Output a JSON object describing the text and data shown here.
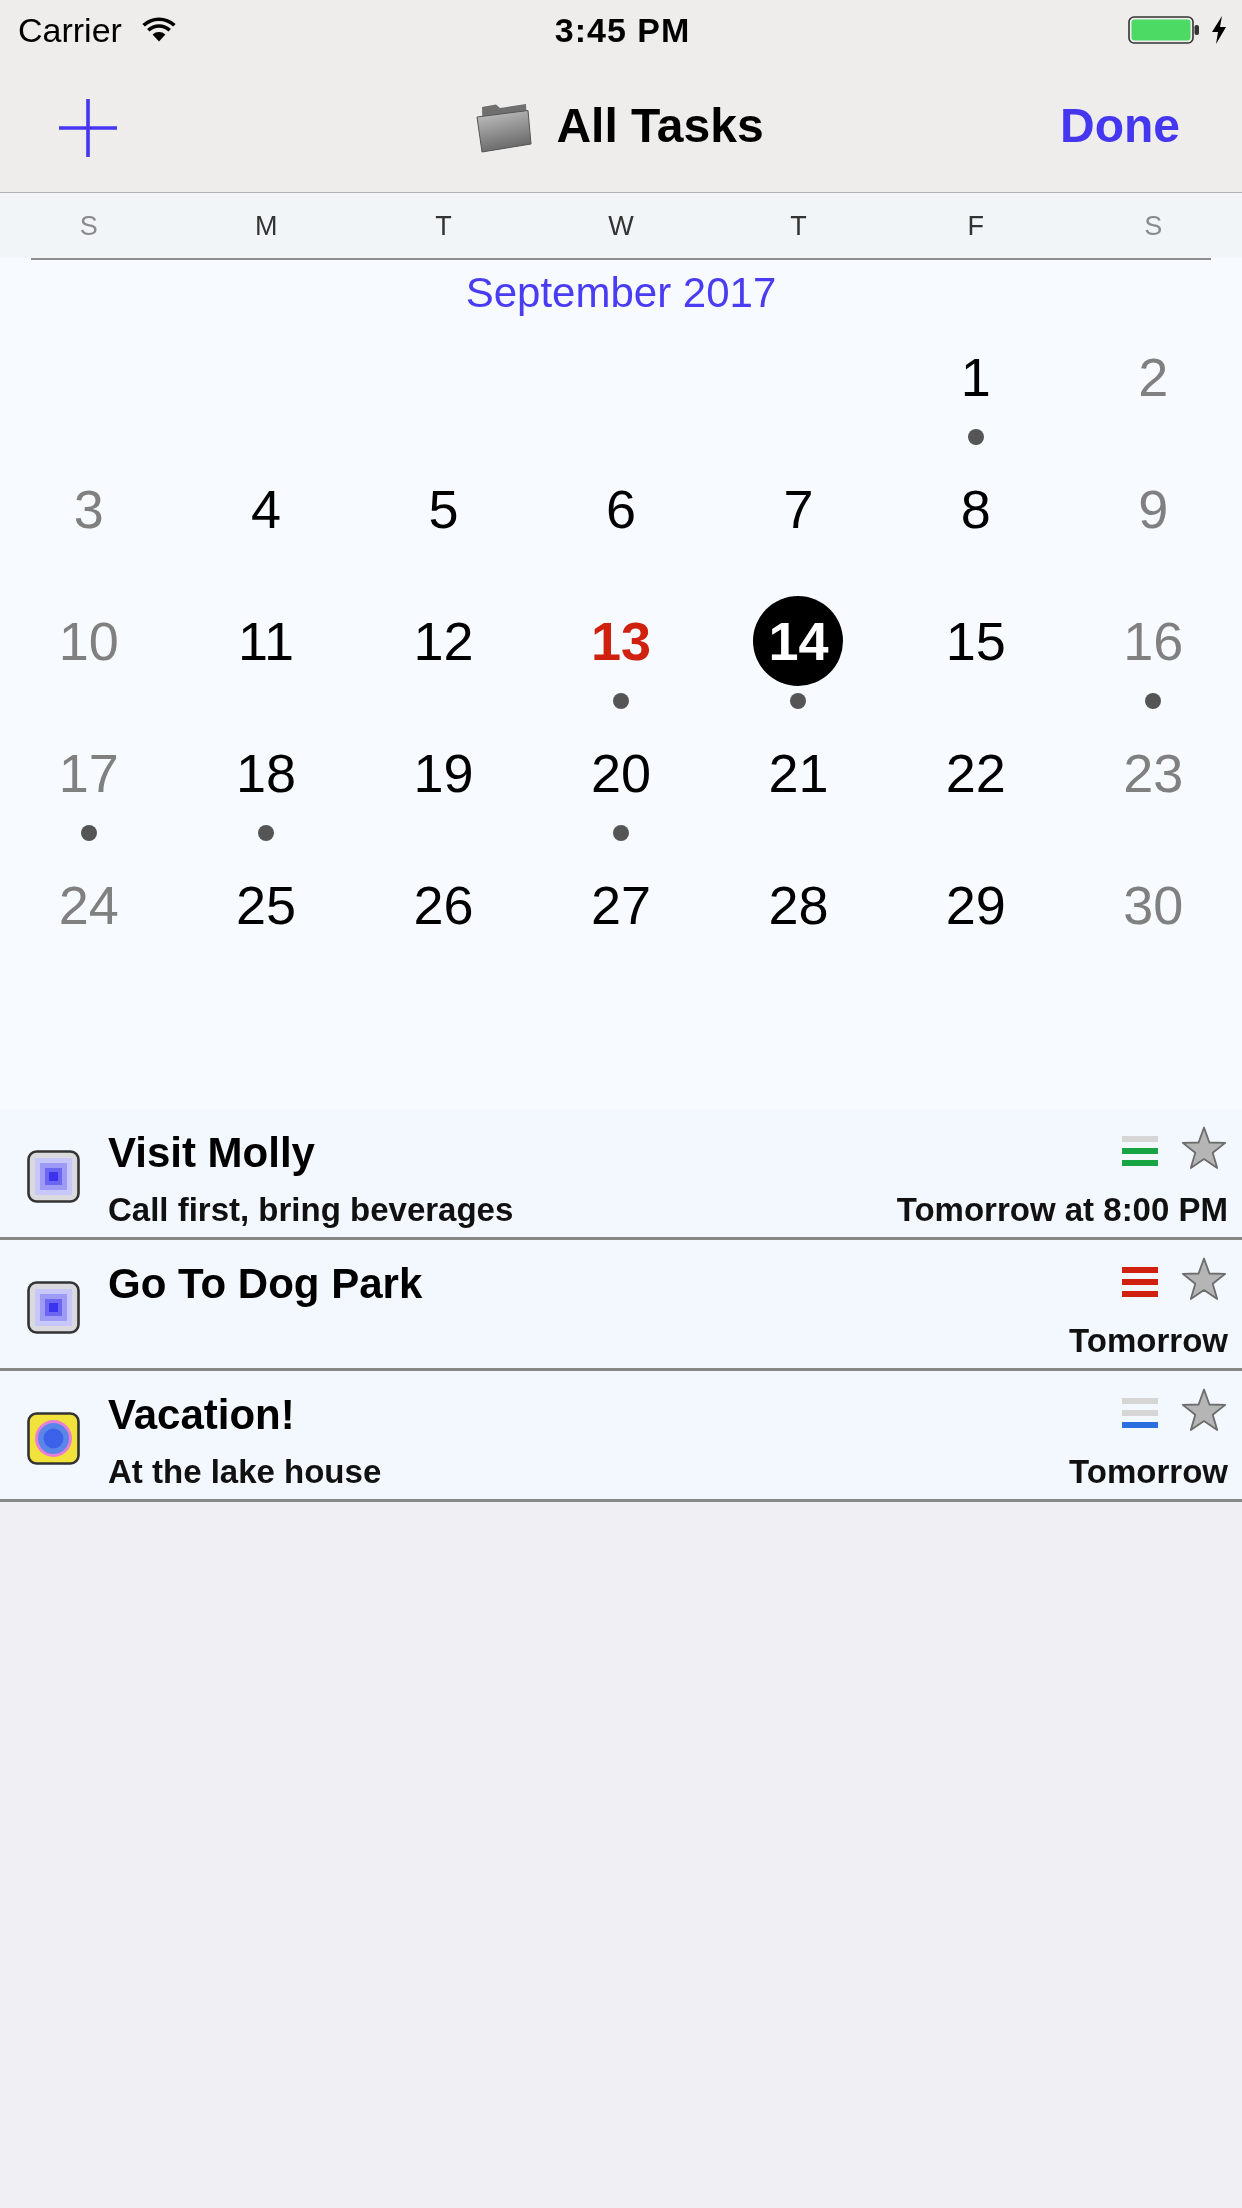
{
  "status_bar": {
    "carrier": "Carrier",
    "time": "3:45 PM"
  },
  "nav_bar": {
    "title": "All Tasks",
    "right_button": "Done"
  },
  "calendar": {
    "weekdays": [
      {
        "label": "S",
        "weekend": true
      },
      {
        "label": "M",
        "weekend": false
      },
      {
        "label": "T",
        "weekend": false
      },
      {
        "label": "W",
        "weekend": false
      },
      {
        "label": "T",
        "weekend": false
      },
      {
        "label": "F",
        "weekend": false
      },
      {
        "label": "S",
        "weekend": true
      }
    ],
    "month": "September 2017",
    "weeks": [
      [
        {
          "label": "1",
          "weekend": false,
          "today": false,
          "selected": false,
          "dot": true
        },
        {
          "label": "2",
          "weekend": true,
          "today": false,
          "selected": false,
          "dot": false
        }
      ],
      [
        {
          "label": "3",
          "weekend": true,
          "today": false,
          "selected": false,
          "dot": false
        },
        {
          "label": "4",
          "weekend": false,
          "today": false,
          "selected": false,
          "dot": false
        },
        {
          "label": "5",
          "weekend": false,
          "today": false,
          "selected": false,
          "dot": false
        },
        {
          "label": "6",
          "weekend": false,
          "today": false,
          "selected": false,
          "dot": false
        },
        {
          "label": "7",
          "weekend": false,
          "today": false,
          "selected": false,
          "dot": false
        },
        {
          "label": "8",
          "weekend": false,
          "today": false,
          "selected": false,
          "dot": false
        },
        {
          "label": "9",
          "weekend": true,
          "today": false,
          "selected": false,
          "dot": false
        }
      ],
      [
        {
          "label": "10",
          "weekend": true,
          "today": false,
          "selected": false,
          "dot": false
        },
        {
          "label": "11",
          "weekend": false,
          "today": false,
          "selected": false,
          "dot": false
        },
        {
          "label": "12",
          "weekend": false,
          "today": false,
          "selected": false,
          "dot": false
        },
        {
          "label": "13",
          "weekend": false,
          "today": true,
          "selected": false,
          "dot": true
        },
        {
          "label": "14",
          "weekend": false,
          "today": false,
          "selected": true,
          "dot": true
        },
        {
          "label": "15",
          "weekend": false,
          "today": false,
          "selected": false,
          "dot": false
        },
        {
          "label": "16",
          "weekend": true,
          "today": false,
          "selected": false,
          "dot": true
        }
      ],
      [
        {
          "label": "17",
          "weekend": true,
          "today": false,
          "selected": false,
          "dot": true
        },
        {
          "label": "18",
          "weekend": false,
          "today": false,
          "selected": false,
          "dot": true
        },
        {
          "label": "19",
          "weekend": false,
          "today": false,
          "selected": false,
          "dot": false
        },
        {
          "label": "20",
          "weekend": false,
          "today": false,
          "selected": false,
          "dot": true
        },
        {
          "label": "21",
          "weekend": false,
          "today": false,
          "selected": false,
          "dot": false
        },
        {
          "label": "22",
          "weekend": false,
          "today": false,
          "selected": false,
          "dot": false
        },
        {
          "label": "23",
          "weekend": true,
          "today": false,
          "selected": false,
          "dot": false
        }
      ],
      [
        {
          "label": "24",
          "weekend": true,
          "today": false,
          "selected": false,
          "dot": false
        },
        {
          "label": "25",
          "weekend": false,
          "today": false,
          "selected": false,
          "dot": false
        },
        {
          "label": "26",
          "weekend": false,
          "today": false,
          "selected": false,
          "dot": false
        },
        {
          "label": "27",
          "weekend": false,
          "today": false,
          "selected": false,
          "dot": false
        },
        {
          "label": "28",
          "weekend": false,
          "today": false,
          "selected": false,
          "dot": false
        },
        {
          "label": "29",
          "weekend": false,
          "today": false,
          "selected": false,
          "dot": false
        },
        {
          "label": "30",
          "weekend": true,
          "today": false,
          "selected": false,
          "dot": false
        }
      ]
    ]
  },
  "tasks": [
    {
      "kind": "square",
      "checked": false,
      "title": "Visit Molly",
      "note": "Call first, bring beverages",
      "color": "#17a544",
      "priority_bars": [
        {
          "filled": false
        },
        {
          "filled": true
        },
        {
          "filled": true
        }
      ],
      "starred": false,
      "due": "Tomorrow at 8:00 PM"
    },
    {
      "kind": "square",
      "checked": false,
      "title": "Go To Dog Park",
      "color": "#d0200f",
      "priority_bars": [
        {
          "filled": true
        },
        {
          "filled": true
        },
        {
          "filled": true
        }
      ],
      "starred": false,
      "due": "Tomorrow"
    },
    {
      "kind": "ring",
      "checked": false,
      "title": "Vacation!",
      "note": "At the lake house",
      "color": "#2a6fe0",
      "priority_bars": [
        {
          "filled": false
        },
        {
          "filled": false
        },
        {
          "filled": true
        }
      ],
      "starred": false,
      "due": "Tomorrow"
    }
  ]
}
